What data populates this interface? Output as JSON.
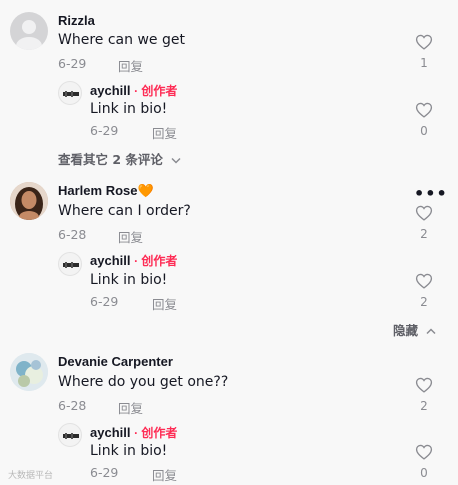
{
  "comments": [
    {
      "author": "Rizzla",
      "text": "Where can we get",
      "date": "6-29",
      "reply_label": "回复",
      "likes": "1",
      "reply": {
        "author": "aychill",
        "creator_tag": "· 创作者",
        "text": "Link in bio!",
        "date": "6-29",
        "reply_label": "回复",
        "likes": "0"
      },
      "more_replies": "查看其它 2 条评论"
    },
    {
      "author": "Harlem Rose",
      "author_emoji": "🧡",
      "text": "Where can I order?",
      "date": "6-28",
      "reply_label": "回复",
      "likes": "2",
      "more_label": "•••",
      "reply": {
        "author": "aychill",
        "creator_tag": "· 创作者",
        "text": "Link in bio!",
        "date": "6-29",
        "reply_label": "回复",
        "likes": "2"
      },
      "hide_label": "隐藏"
    },
    {
      "author": "Devanie Carpenter",
      "text": "Where do you get one??",
      "date": "6-28",
      "reply_label": "回复",
      "likes": "2",
      "reply": {
        "author": "aychill",
        "creator_tag": "· 创作者",
        "text": "Link in bio!",
        "date": "6-29",
        "reply_label": "回复",
        "likes": "0"
      }
    }
  ],
  "watermark": "大数据平台",
  "colors": {
    "creator": "#fe2c55",
    "muted": "#8a8b91",
    "background": "#f8f8f8"
  }
}
